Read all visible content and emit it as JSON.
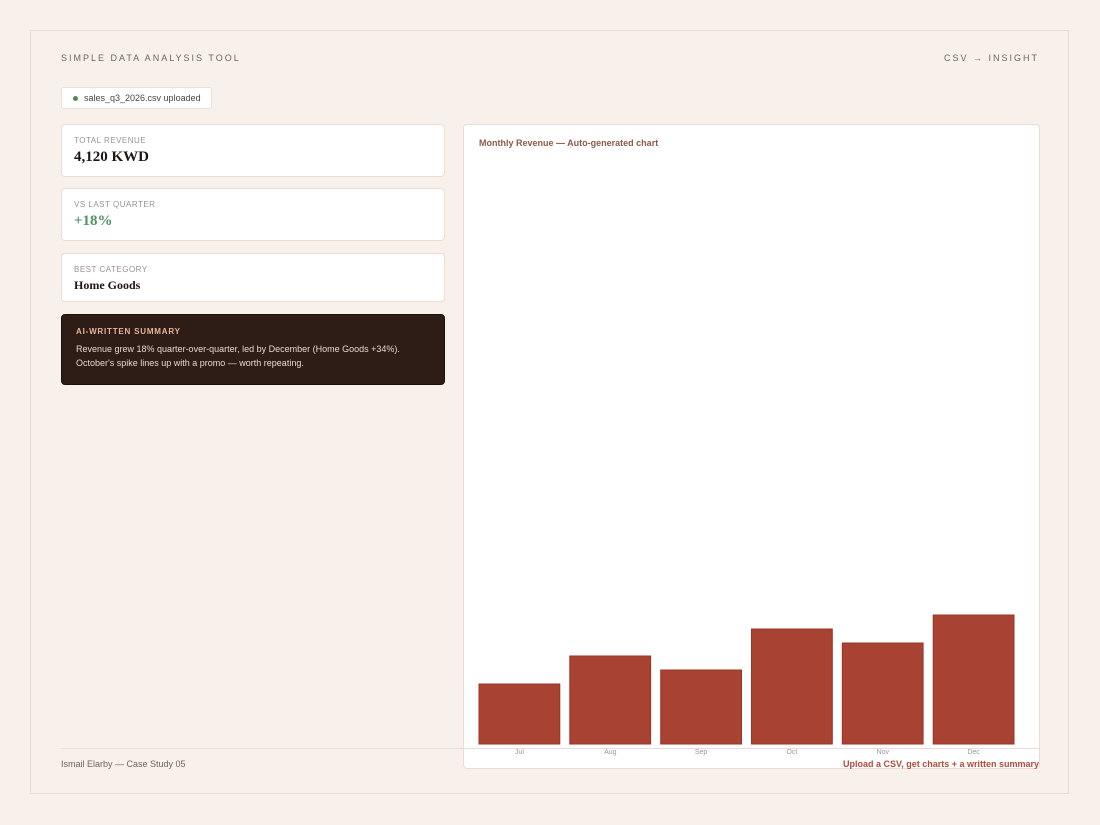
{
  "header": {
    "tool_title": "SIMPLE DATA ANALYSIS TOOL",
    "tagline": "CSV → INSIGHT"
  },
  "upload": {
    "status_text": "sales_q3_2026.csv uploaded",
    "status_color": "#4c8a5a"
  },
  "stats": {
    "revenue": {
      "label": "TOTAL REVENUE",
      "value": "4,120 KWD"
    },
    "vs_quarter": {
      "label": "VS LAST QUARTER",
      "value": "+18%"
    },
    "best_category": {
      "label": "BEST CATEGORY",
      "value": "Home Goods"
    }
  },
  "summary": {
    "label": "AI-WRITTEN SUMMARY",
    "text": "Revenue grew 18% quarter-over-quarter, led by December (Home Goods +34%). October's spike lines up with a promo — worth repeating."
  },
  "chart": {
    "title": "Monthly Revenue — Auto-generated chart",
    "bar_color": "#a84232"
  },
  "chart_data": {
    "type": "bar",
    "title": "Monthly Revenue — Auto-generated chart",
    "categories": [
      "Jul",
      "Aug",
      "Sep",
      "Oct",
      "Nov",
      "Dec"
    ],
    "values": [
      60,
      88,
      74,
      115,
      101,
      129
    ],
    "ylim": [
      0,
      580
    ],
    "grid": false
  },
  "footer": {
    "author": "Ismail Elarby — Case Study 05",
    "tagline": "Upload a CSV, get charts + a written summary"
  }
}
